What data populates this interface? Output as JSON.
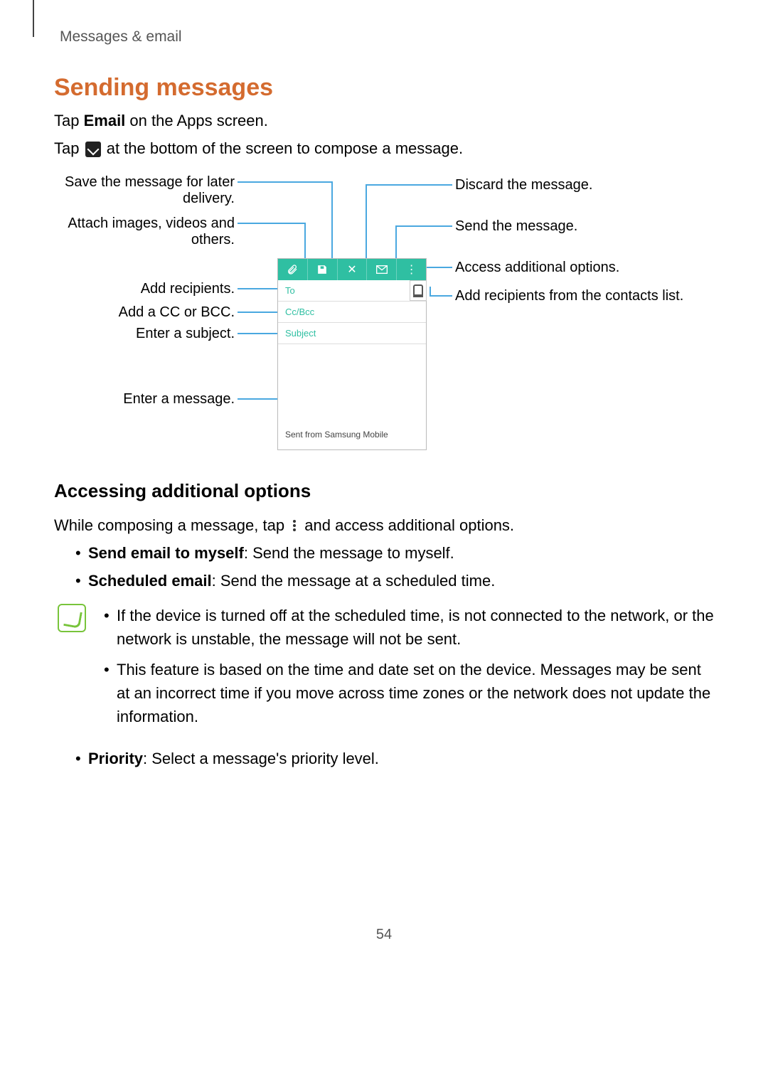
{
  "header": {
    "section_label": "Messages & email"
  },
  "title": "Sending messages",
  "intro": {
    "p1_a": "Tap ",
    "p1_b": "Email",
    "p1_c": " on the Apps screen.",
    "p2_a": "Tap ",
    "p2_b": " at the bottom of the screen to compose a message."
  },
  "callouts": {
    "save": "Save the message for later delivery.",
    "attach": "Attach images, videos and others.",
    "recipients": "Add recipients.",
    "ccbcc": "Add a CC or BCC.",
    "subject": "Enter a subject.",
    "message": "Enter a message.",
    "discard": "Discard the message.",
    "send": "Send the message.",
    "options": "Access additional options.",
    "contacts": "Add recipients from the contacts list."
  },
  "phone": {
    "to": "To",
    "ccbcc": "Cc/Bcc",
    "subject": "Subject",
    "body": "Sent from Samsung Mobile"
  },
  "subheading": "Accessing additional options",
  "sub_para_a": "While composing a message, tap ",
  "sub_para_b": " and access additional options.",
  "options_list": {
    "item1_b": "Send email to myself",
    "item1_t": ": Send the message to myself.",
    "item2_b": "Scheduled email",
    "item2_t": ": Send the message at a scheduled time.",
    "item3_b": "Priority",
    "item3_t": ": Select a message's priority level."
  },
  "notes": {
    "n1": "If the device is turned off at the scheduled time, is not connected to the network, or the network is unstable, the message will not be sent.",
    "n2": "This feature is based on the time and date set on the device. Messages may be sent at an incorrect time if you move across time zones or the network does not update the information."
  },
  "page_number": "54"
}
